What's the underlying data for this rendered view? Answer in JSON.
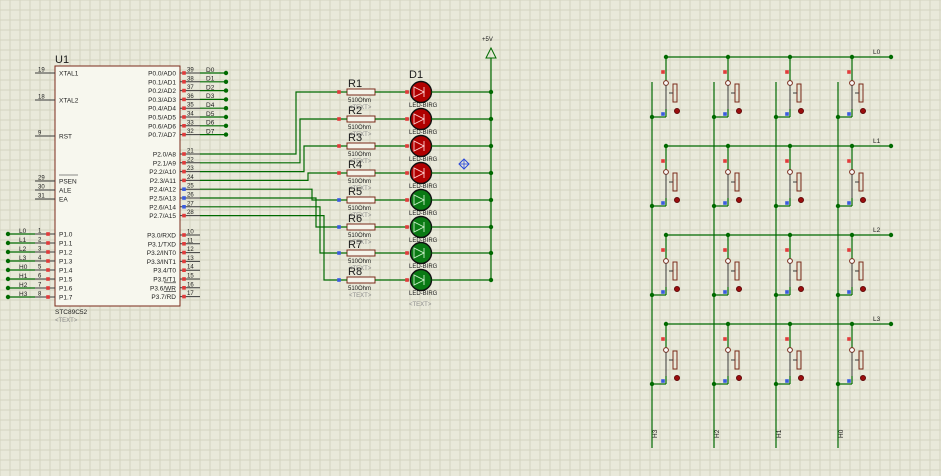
{
  "mcu": {
    "ref": "U1",
    "part": "STC89C52",
    "text_tag": "<TEXT>",
    "left_pins": [
      {
        "num": "19",
        "label": "XTAL1"
      },
      {
        "num": "18",
        "label": "XTAL2"
      },
      {
        "num": "9",
        "label": "RST"
      },
      {
        "num": "29",
        "label": "PSEN"
      },
      {
        "num": "30",
        "label": "ALE"
      },
      {
        "num": "31",
        "label": "EA"
      },
      {
        "num": "1",
        "label": "P1.0"
      },
      {
        "num": "2",
        "label": "P1.1"
      },
      {
        "num": "3",
        "label": "P1.2"
      },
      {
        "num": "4",
        "label": "P1.3"
      },
      {
        "num": "5",
        "label": "P1.4"
      },
      {
        "num": "6",
        "label": "P1.5"
      },
      {
        "num": "7",
        "label": "P1.6"
      },
      {
        "num": "8",
        "label": "P1.7"
      }
    ],
    "right_pins": [
      {
        "num": "39",
        "label": "P0.0/AD0"
      },
      {
        "num": "38",
        "label": "P0.1/AD1"
      },
      {
        "num": "37",
        "label": "P0.2/AD2"
      },
      {
        "num": "36",
        "label": "P0.3/AD3"
      },
      {
        "num": "35",
        "label": "P0.4/AD4"
      },
      {
        "num": "34",
        "label": "P0.5/AD5"
      },
      {
        "num": "33",
        "label": "P0.6/AD6"
      },
      {
        "num": "32",
        "label": "P0.7/AD7"
      },
      {
        "num": "21",
        "label": "P2.0/A8"
      },
      {
        "num": "22",
        "label": "P2.1/A9"
      },
      {
        "num": "23",
        "label": "P2.2/A10"
      },
      {
        "num": "24",
        "label": "P2.3/A11"
      },
      {
        "num": "25",
        "label": "P2.4/A12"
      },
      {
        "num": "26",
        "label": "P2.5/A13"
      },
      {
        "num": "27",
        "label": "P2.6/A14"
      },
      {
        "num": "28",
        "label": "P2.7/A15"
      },
      {
        "num": "10",
        "label": "P3.0/RXD"
      },
      {
        "num": "11",
        "label": "P3.1/TXD"
      },
      {
        "num": "12",
        "label": "P3.2/INT0"
      },
      {
        "num": "13",
        "label": "P3.3/INT1"
      },
      {
        "num": "14",
        "label": "P3.4/T0"
      },
      {
        "num": "15",
        "label": "P3.5/T1"
      },
      {
        "num": "16",
        "label": "P3.6/WR"
      },
      {
        "num": "17",
        "label": "P3.7/RD"
      }
    ],
    "port0_nets": [
      "D0",
      "D1",
      "D2",
      "D3",
      "D4",
      "D5",
      "D6",
      "D7"
    ],
    "port1_nets": [
      "L0",
      "L1",
      "L2",
      "L3",
      "H0",
      "H1",
      "H2",
      "H3"
    ]
  },
  "resistors": {
    "refs": [
      "R1",
      "R2",
      "R3",
      "R4",
      "R5",
      "R6",
      "R7",
      "R8"
    ],
    "value": "510Ohm",
    "text_tag": "<TEXT>"
  },
  "leds": {
    "ref": "D1",
    "part": "LED-BIRG",
    "text_tag": "<TEXT>",
    "states": [
      "red",
      "red",
      "red",
      "red",
      "green",
      "green",
      "green",
      "green"
    ]
  },
  "power": {
    "label": "+5V"
  },
  "keypad": {
    "row_labels": [
      "L0",
      "L1",
      "L2",
      "L3"
    ],
    "col_labels": [
      "H3",
      "H2",
      "H1",
      "H0"
    ]
  },
  "colors": {
    "wire": "#006a00",
    "chip_border": "#7a2a1a",
    "led_red": "#b00000",
    "led_green": "#0a7a14",
    "pin_red": "#e23b3b",
    "pin_blue": "#3a5be0",
    "background": "#e9e9da"
  }
}
